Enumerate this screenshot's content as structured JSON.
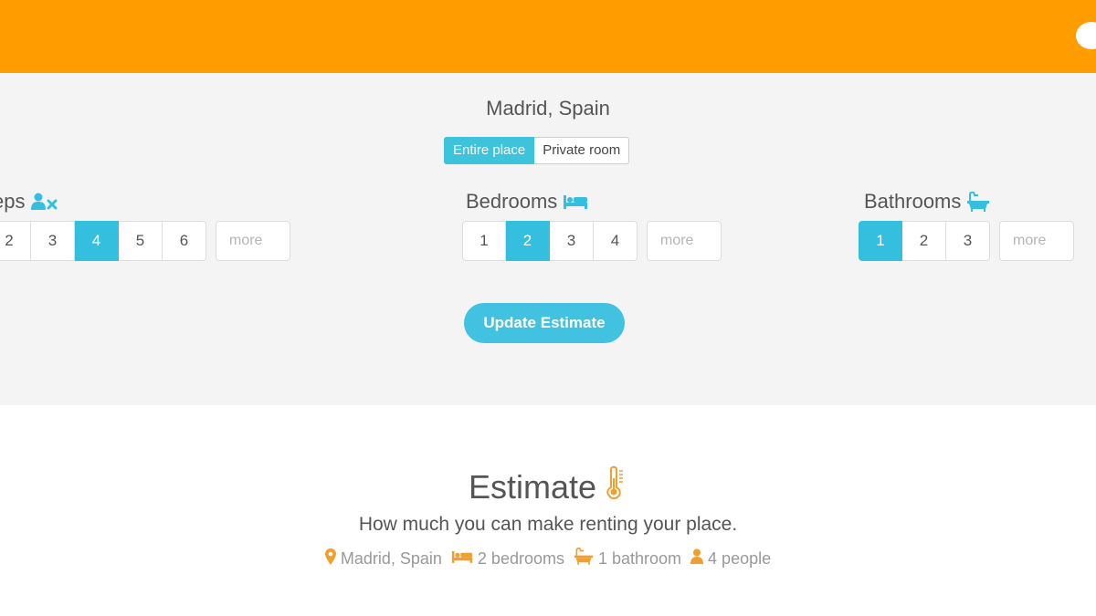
{
  "colors": {
    "header": "#ff9c00",
    "accent": "#35bfdf",
    "icon_orange": "#f0a030"
  },
  "form": {
    "location": "Madrid, Spain",
    "room_types": [
      {
        "label": "Entire place",
        "selected": true
      },
      {
        "label": "Private room",
        "selected": false
      }
    ],
    "sleeps": {
      "label": "eps",
      "icon": "user-x-icon",
      "options": [
        "2",
        "3",
        "4",
        "5",
        "6"
      ],
      "selected": "4",
      "more_placeholder": "more"
    },
    "bedrooms": {
      "label": "Bedrooms",
      "icon": "bed-icon",
      "options": [
        "1",
        "2",
        "3",
        "4"
      ],
      "selected": "2",
      "more_placeholder": "more"
    },
    "bathrooms": {
      "label": "Bathrooms",
      "icon": "bathtub-icon",
      "options": [
        "1",
        "2",
        "3"
      ],
      "selected": "1",
      "more_placeholder": "more"
    },
    "update_button": "Update Estimate"
  },
  "estimate": {
    "title": "Estimate",
    "title_icon": "thermometer-icon",
    "subtitle": "How much you can make renting your place.",
    "summary": {
      "location": "Madrid, Spain",
      "bedrooms": "2 bedrooms",
      "bathrooms": "1 bathroom",
      "people": "4 people"
    }
  }
}
